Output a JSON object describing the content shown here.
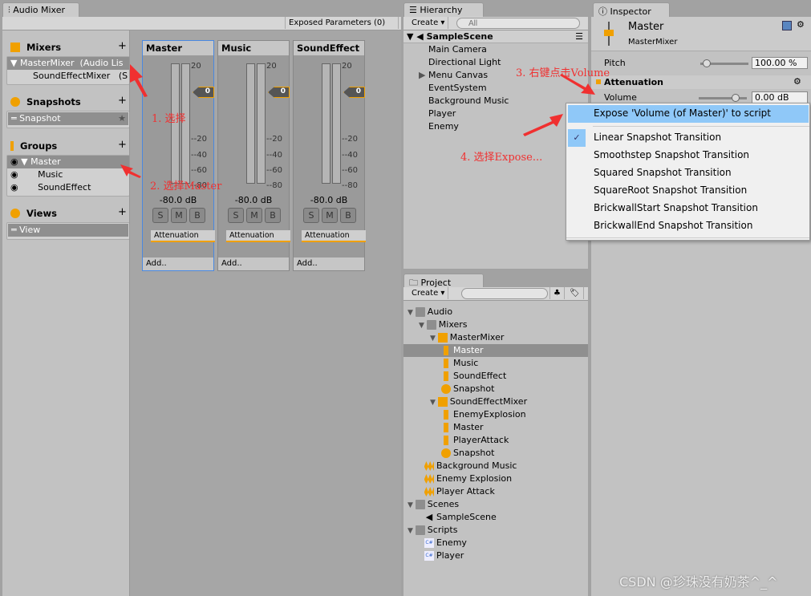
{
  "audio_mixer": {
    "tab": "Audio Mixer",
    "exposed_params": "Exposed Parameters (0)",
    "mixers": {
      "title": "Mixers",
      "items": [
        {
          "name": "MasterMixer",
          "note": "(Audio Lis"
        },
        {
          "name": "SoundEffectMixer",
          "note": "(S"
        }
      ]
    },
    "snapshots": {
      "title": "Snapshots",
      "items": [
        "Snapshot"
      ]
    },
    "groups": {
      "title": "Groups",
      "items": [
        "Master",
        "Music",
        "SoundEffect"
      ]
    },
    "views": {
      "title": "Views",
      "items": [
        "View"
      ]
    },
    "strips": [
      {
        "name": "Master",
        "db": "-80.0 dB",
        "knob": "0",
        "effect": "Attenuation",
        "add": "Add.."
      },
      {
        "name": "Music",
        "db": "-80.0 dB",
        "knob": "0",
        "effect": "Attenuation",
        "add": "Add.."
      },
      {
        "name": "SoundEffect",
        "db": "-80.0 dB",
        "knob": "0",
        "effect": "Attenuation",
        "add": "Add.."
      }
    ],
    "scale": [
      "20",
      "-",
      "-20",
      "-40",
      "-60",
      "-80"
    ],
    "buttons": [
      "S",
      "M",
      "B"
    ]
  },
  "hierarchy": {
    "tab": "Hierarchy",
    "create": "Create",
    "search_placeholder": "All",
    "scene": "SampleScene",
    "items": [
      "Main Camera",
      "Directional Light",
      "Menu Canvas",
      "EventSystem",
      "Background Music",
      "Player",
      "Enemy"
    ]
  },
  "project": {
    "tab": "Project",
    "create": "Create",
    "items": [
      {
        "label": "Audio",
        "depth": 0,
        "icon": "folder"
      },
      {
        "label": "Mixers",
        "depth": 1,
        "icon": "folder"
      },
      {
        "label": "MasterMixer",
        "depth": 2,
        "icon": "mixer"
      },
      {
        "label": "Master",
        "depth": 3,
        "icon": "group",
        "selected": true
      },
      {
        "label": "Music",
        "depth": 3,
        "icon": "group"
      },
      {
        "label": "SoundEffect",
        "depth": 3,
        "icon": "group"
      },
      {
        "label": "Snapshot",
        "depth": 3,
        "icon": "snapshot"
      },
      {
        "label": "SoundEffectMixer",
        "depth": 2,
        "icon": "mixer"
      },
      {
        "label": "EnemyExplosion",
        "depth": 3,
        "icon": "group"
      },
      {
        "label": "Master",
        "depth": 3,
        "icon": "group"
      },
      {
        "label": "PlayerAttack",
        "depth": 3,
        "icon": "group"
      },
      {
        "label": "Snapshot",
        "depth": 3,
        "icon": "snapshot"
      },
      {
        "label": "Background Music",
        "depth": 1.5,
        "icon": "audio"
      },
      {
        "label": "Enemy Explosion",
        "depth": 1.5,
        "icon": "audio"
      },
      {
        "label": "Player Attack",
        "depth": 1.5,
        "icon": "audio"
      },
      {
        "label": "Scenes",
        "depth": 0,
        "icon": "folder"
      },
      {
        "label": "SampleScene",
        "depth": 1.5,
        "icon": "unity"
      },
      {
        "label": "Scripts",
        "depth": 0,
        "icon": "folder"
      },
      {
        "label": "Enemy",
        "depth": 1.5,
        "icon": "csharp"
      },
      {
        "label": "Player",
        "depth": 1.5,
        "icon": "csharp"
      }
    ]
  },
  "inspector": {
    "tab": "Inspector",
    "title": "Master",
    "subtitle": "MasterMixer",
    "pitch_label": "Pitch",
    "pitch_value": "100.00 %",
    "section": "Attenuation",
    "volume_label": "Volume",
    "volume_value": "0.00 dB"
  },
  "context_menu": {
    "items": [
      "Expose 'Volume (of Master)' to script",
      "Linear Snapshot Transition",
      "Smoothstep Snapshot Transition",
      "Squared Snapshot Transition",
      "SquareRoot Snapshot Transition",
      "BrickwallStart Snapshot Transition",
      "BrickwallEnd Snapshot Transition"
    ],
    "checked": "Linear Snapshot Transition"
  },
  "annotations": [
    "1. 选择",
    "2. 选择Master",
    "3. 右键点击Volume",
    "4. 选择Expose..."
  ],
  "watermark": "CSDN @珍珠没有奶茶^_^",
  "colors": {
    "accent": "#f0a000",
    "selection": "#8fc8f8",
    "annotation": "#f03030"
  }
}
